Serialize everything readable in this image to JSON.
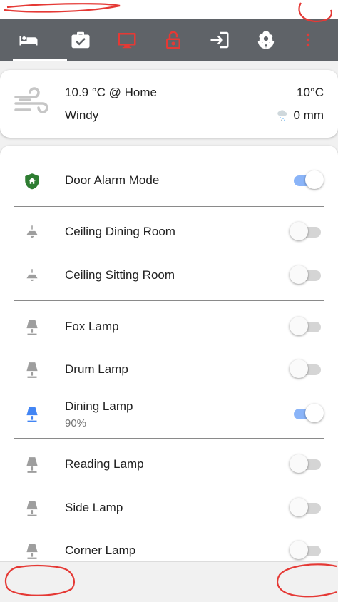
{
  "colors": {
    "toolbar_bg": "#5f6368",
    "accent_blue": "#4285f4",
    "alert_red": "#e53935",
    "shield_green": "#2e7d32",
    "icon_gray": "#9e9e9e"
  },
  "toolbar": {
    "tabs": [
      {
        "icon": "bed-icon",
        "active": true
      },
      {
        "icon": "briefcase-check-icon",
        "active": false
      },
      {
        "icon": "television-icon",
        "active": false,
        "color": "#e53935"
      },
      {
        "icon": "lock-open-icon",
        "active": false,
        "color": "#e53935"
      },
      {
        "icon": "login-icon",
        "active": false
      },
      {
        "icon": "flower-icon",
        "active": false
      }
    ],
    "overflow_icon": "more-vertical-icon"
  },
  "weather": {
    "icon": "wind-icon",
    "temperature_location": "10.9 °C @ Home",
    "condition": "Windy",
    "outside_temp": "10°C",
    "precip_icon": "snow-rain-icon",
    "precipitation": "0 mm"
  },
  "entities": [
    {
      "label": "Door Alarm Mode",
      "icon": "shield-home-icon",
      "on": true
    },
    {
      "label": "Ceiling Dining Room",
      "icon": "ceiling-light-icon",
      "on": false
    },
    {
      "label": "Ceiling Sitting Room",
      "icon": "ceiling-light-icon",
      "on": false
    },
    {
      "label": "Fox Lamp",
      "icon": "lamp-icon",
      "on": false
    },
    {
      "label": "Drum Lamp",
      "icon": "lamp-icon",
      "on": false
    },
    {
      "label": "Dining Lamp",
      "icon": "lamp-icon",
      "on": true,
      "secondary": "90%"
    },
    {
      "label": "Reading Lamp",
      "icon": "lamp-icon",
      "on": false
    },
    {
      "label": "Side Lamp",
      "icon": "lamp-icon",
      "on": false
    },
    {
      "label": "Corner Lamp",
      "icon": "lamp-icon",
      "on": false
    }
  ]
}
